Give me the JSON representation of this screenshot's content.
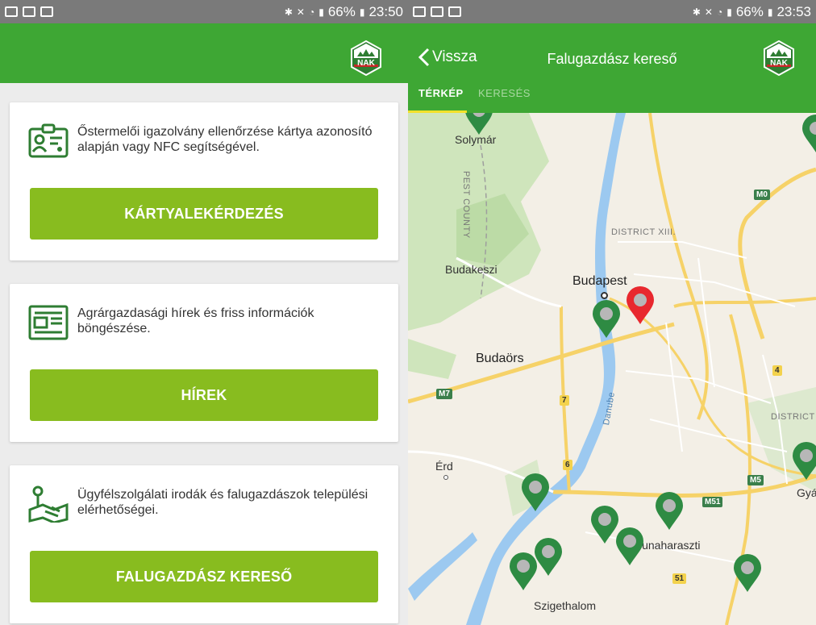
{
  "status_left": {
    "battery": "66%",
    "time": "23:50"
  },
  "status_right": {
    "battery": "66%",
    "time": "23:53"
  },
  "logo_text": "NAK",
  "cards": [
    {
      "icon": "id-card-icon",
      "text": "Őstermelői igazolvány ellenőrzése kártya azonosító alapján vagy NFC segítségével.",
      "button": "KÁRTYALEKÉRDEZÉS"
    },
    {
      "icon": "newspaper-icon",
      "text": "Agrárgazdasági hírek és friss információk böngészése.",
      "button": "HÍREK"
    },
    {
      "icon": "map-pin-icon",
      "text": "Ügyfélszolgálati irodák és falugazdászok települési elérhetőségei.",
      "button": "FALUGAZDÁSZ KERESŐ"
    }
  ],
  "right": {
    "back_label": "Vissza",
    "title": "Falugazdász kereső",
    "tabs": [
      {
        "label": "TÉRKÉP",
        "active": true
      },
      {
        "label": "KERESÉS",
        "active": false
      }
    ]
  },
  "map_labels": {
    "solymar": "Solymár",
    "pest_county": "PEST COUNTY",
    "budakeszi": "Budakeszi",
    "budapest": "Budapest",
    "budaors": "Budaörs",
    "erd": "Érd",
    "dunaharaszti": "Dunaharaszti",
    "szigethalom": "Szigethalom",
    "gya": "Gyá",
    "district_xiii": "DISTRICT XIII.",
    "district_x": "DISTRICT X",
    "danube": "Danube",
    "m0": "M0",
    "m7": "M7",
    "m5": "M5",
    "m51": "M51",
    "r4": "4",
    "r7": "7",
    "r6": "6",
    "r51": "51"
  },
  "colors": {
    "brand_green": "#3ea734",
    "button_green": "#88bc1f",
    "pin_green": "#2e8b43",
    "pin_red": "#e8282e",
    "tab_indicator": "#f2e12a"
  }
}
